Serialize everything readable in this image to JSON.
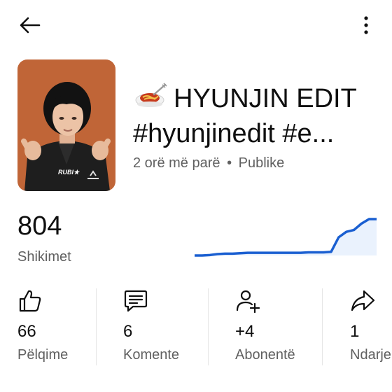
{
  "video": {
    "title_line1": "HYUNJIN EDIT",
    "title_line2": "#hyunjinedit  #e...",
    "title_emoji": "spaghetti-emoji",
    "time_ago": "2 orë më parë",
    "separator": "•",
    "visibility": "Publike",
    "thumbnail": {
      "jacket_text": "RUBI★"
    }
  },
  "views": {
    "count": "804",
    "label": "Shikimet"
  },
  "sparkline": {
    "color": "#1a5fd1",
    "values": [
      0,
      0,
      0.5,
      1.5,
      2,
      2,
      2.5,
      3,
      3,
      3,
      3,
      3,
      3,
      3,
      3,
      3.5,
      3.5,
      3.5,
      4,
      20,
      26,
      28,
      35,
      40,
      40
    ]
  },
  "stats": [
    {
      "icon": "thumbs-up-icon",
      "value": "66",
      "label": "Pëlqime"
    },
    {
      "icon": "comment-icon",
      "value": "6",
      "label": "Komente"
    },
    {
      "icon": "add-person-icon",
      "value": "+4",
      "label": "Abonentë"
    },
    {
      "icon": "share-icon",
      "value": "1",
      "label": "Ndarje"
    }
  ],
  "nav": {
    "back_icon": "arrow-left-icon",
    "more_icon": "more-vert-icon"
  },
  "colors": {
    "text": "#0f0f0f",
    "secondary": "#606060",
    "accent": "#1a5fd1",
    "thumb_bg": "#c5683a"
  }
}
